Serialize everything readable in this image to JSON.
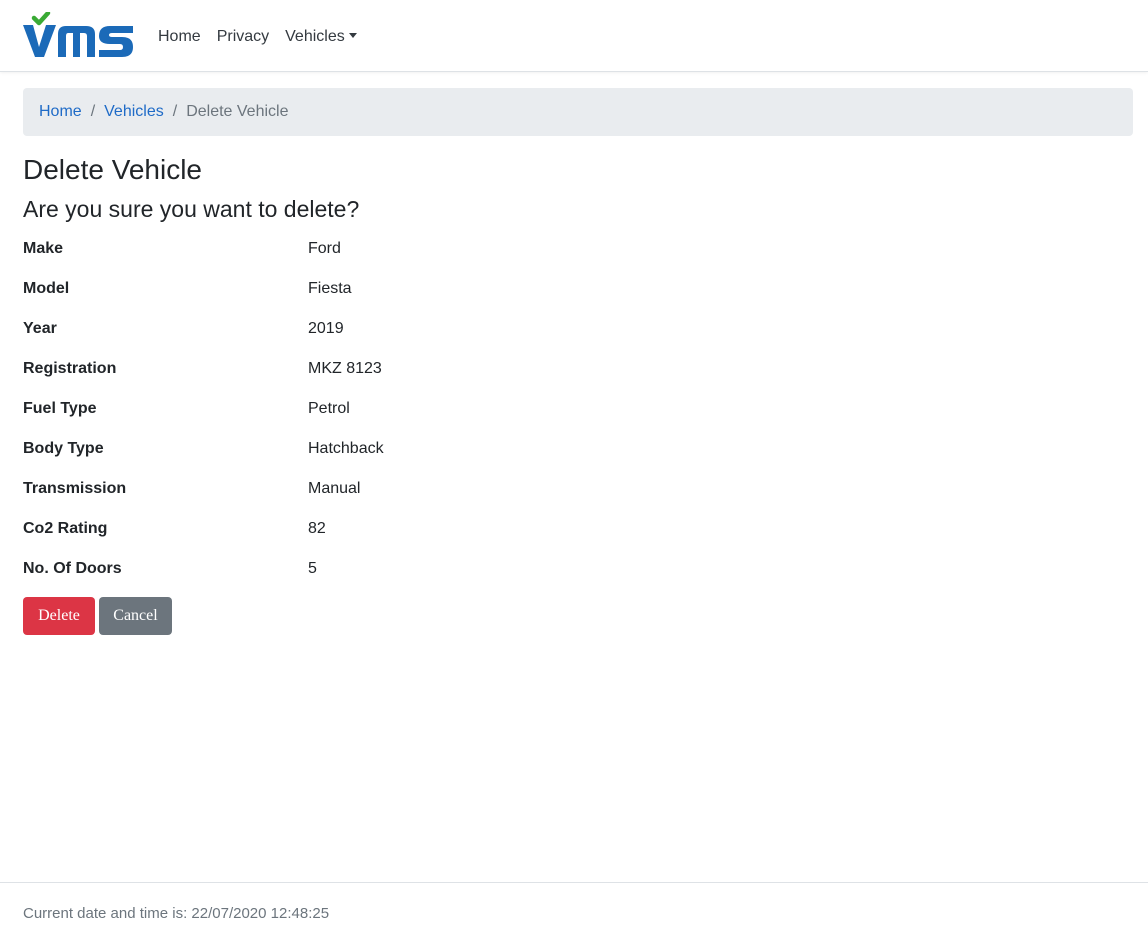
{
  "brand": {
    "logo_text": "VMS",
    "colors": {
      "blue": "#1b6ab8",
      "green": "#3aaa35"
    }
  },
  "nav": {
    "home": "Home",
    "privacy": "Privacy",
    "vehicles": "Vehicles"
  },
  "breadcrumb": {
    "home": "Home",
    "vehicles": "Vehicles",
    "current": "Delete Vehicle",
    "separator": "/"
  },
  "page": {
    "title": "Delete Vehicle",
    "subtitle": "Are you sure you want to delete?"
  },
  "vehicle": {
    "fields": [
      {
        "label": "Make",
        "value": "Ford"
      },
      {
        "label": "Model",
        "value": "Fiesta"
      },
      {
        "label": "Year",
        "value": "2019"
      },
      {
        "label": "Registration",
        "value": "MKZ 8123"
      },
      {
        "label": "Fuel Type",
        "value": "Petrol"
      },
      {
        "label": "Body Type",
        "value": "Hatchback"
      },
      {
        "label": "Transmission",
        "value": "Manual"
      },
      {
        "label": "Co2 Rating",
        "value": "82"
      },
      {
        "label": "No. Of Doors",
        "value": "5"
      }
    ]
  },
  "actions": {
    "delete": "Delete",
    "cancel": "Cancel",
    "colors": {
      "danger": "#dc3545",
      "secondary": "#6c757d"
    }
  },
  "footer": {
    "text": "Current date and time is: 22/07/2020 12:48:25"
  }
}
